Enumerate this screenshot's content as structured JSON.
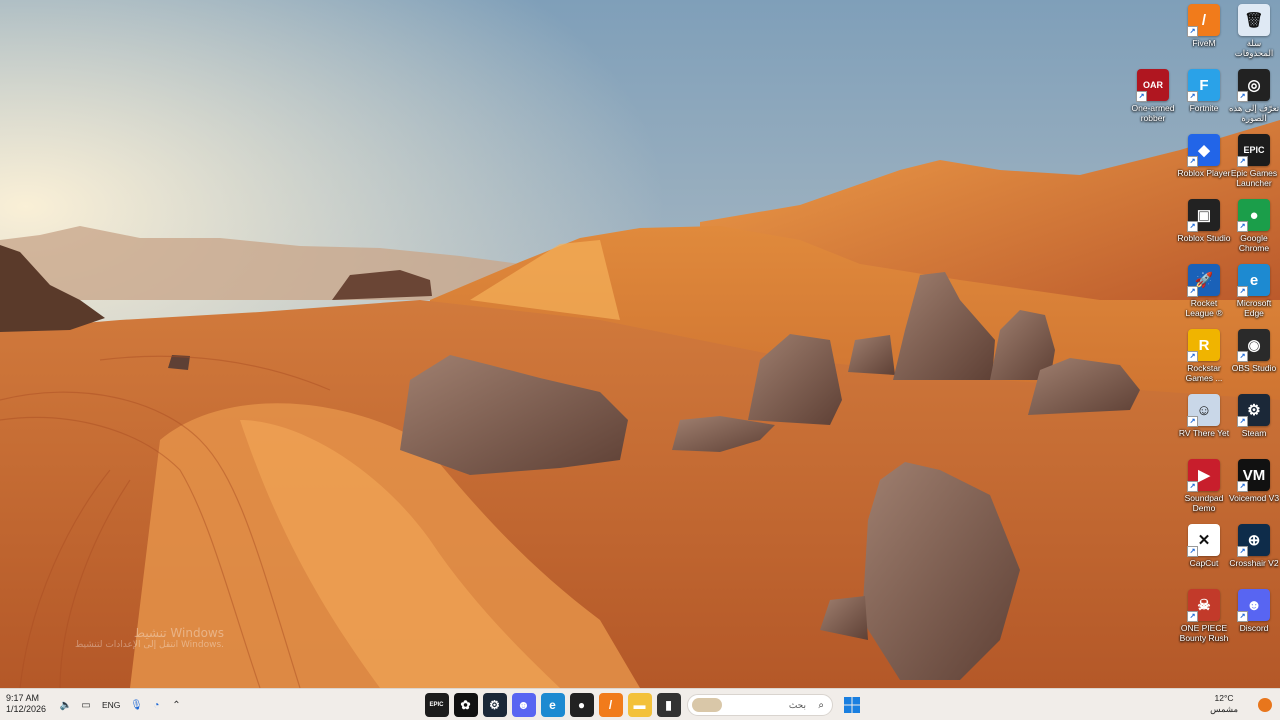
{
  "desktop": {
    "icons": [
      {
        "label": "FiveM",
        "name": "fivem-icon",
        "color": "#f17b1b",
        "glyph": "/"
      },
      {
        "label": "سلة المحذوفات",
        "name": "recycle-bin-icon",
        "color": "#dfe9f4",
        "glyph": "🗑"
      },
      {
        "label": "One-armed robber",
        "name": "one-armed-robber-icon",
        "color": "#b01620",
        "glyph": "OAR"
      },
      {
        "label": "Fortnite",
        "name": "fortnite-icon",
        "color": "#2aa2e8",
        "glyph": "F"
      },
      {
        "label": "تعرّف إلى هذه الصورة",
        "name": "learn-about-picture-icon",
        "color": "#222",
        "glyph": "◎"
      },
      {
        "label": "Roblox Player",
        "name": "roblox-player-icon",
        "color": "#2265e8",
        "glyph": "◆"
      },
      {
        "label": "Epic Games Launcher",
        "name": "epic-games-icon",
        "color": "#1c1c1c",
        "glyph": "EPIC"
      },
      {
        "label": "Roblox Studio",
        "name": "roblox-studio-icon",
        "color": "#222",
        "glyph": "▣"
      },
      {
        "label": "Google Chrome",
        "name": "chrome-icon",
        "color": "#1b9e4a",
        "glyph": "●"
      },
      {
        "label": "Rocket League ®",
        "name": "rocket-league-icon",
        "color": "#1a61b8",
        "glyph": "🚀"
      },
      {
        "label": "Microsoft Edge",
        "name": "edge-icon",
        "color": "#1d8ad1",
        "glyph": "e"
      },
      {
        "label": "Rockstar Games ...",
        "name": "rockstar-icon",
        "color": "#f0b400",
        "glyph": "R"
      },
      {
        "label": "OBS Studio",
        "name": "obs-icon",
        "color": "#2a2a2a",
        "glyph": "◉"
      },
      {
        "label": "RV There Yet",
        "name": "rv-there-yet-icon",
        "color": "#c9d7e8",
        "glyph": "☺"
      },
      {
        "label": "Steam",
        "name": "steam-icon",
        "color": "#1b2838",
        "glyph": "⚙"
      },
      {
        "label": "Soundpad Demo",
        "name": "soundpad-icon",
        "color": "#c81e2c",
        "glyph": "▶"
      },
      {
        "label": "Voicemod V3",
        "name": "voicemod-icon",
        "color": "#111",
        "glyph": "VM"
      },
      {
        "label": "CapCut",
        "name": "capcut-icon",
        "color": "#fff",
        "glyph": "✕"
      },
      {
        "label": "Crosshair V2",
        "name": "crosshair-icon",
        "color": "#0e2c4a",
        "glyph": "⊕"
      },
      {
        "label": "ONE PIECE Bounty Rush",
        "name": "one-piece-icon",
        "color": "#c23a2a",
        "glyph": "☠"
      },
      {
        "label": "Discord",
        "name": "discord-icon",
        "color": "#5865f2",
        "glyph": "☻"
      }
    ],
    "watermark_title": "تنشيط Windows",
    "watermark_sub": "انتقل إلى الإعدادات لتنشيط Windows."
  },
  "taskbar": {
    "time": "9:17 AM",
    "date": "1/12/2026",
    "language": "ENG",
    "search_placeholder": "بحث",
    "weather_temp": "12°C",
    "weather_desc": "مشمس",
    "apps": [
      {
        "name": "epic-games-taskbar-icon",
        "color": "#1c1c1c",
        "glyph": "EPIC"
      },
      {
        "name": "chatgpt-taskbar-icon",
        "color": "#111",
        "glyph": "✿"
      },
      {
        "name": "steam-taskbar-icon",
        "color": "#1b2838",
        "glyph": "⚙"
      },
      {
        "name": "discord-taskbar-icon",
        "color": "#5865f2",
        "glyph": "☻"
      },
      {
        "name": "edge-taskbar-icon",
        "color": "#1d8ad1",
        "glyph": "e"
      },
      {
        "name": "browser-taskbar-icon",
        "color": "#222",
        "glyph": "●"
      },
      {
        "name": "fivem-taskbar-icon",
        "color": "#f17b1b",
        "glyph": "/"
      },
      {
        "name": "file-explorer-taskbar-icon",
        "color": "#f3c13a",
        "glyph": "▬"
      },
      {
        "name": "terminal-taskbar-icon",
        "color": "#333",
        "glyph": "▮"
      }
    ]
  }
}
